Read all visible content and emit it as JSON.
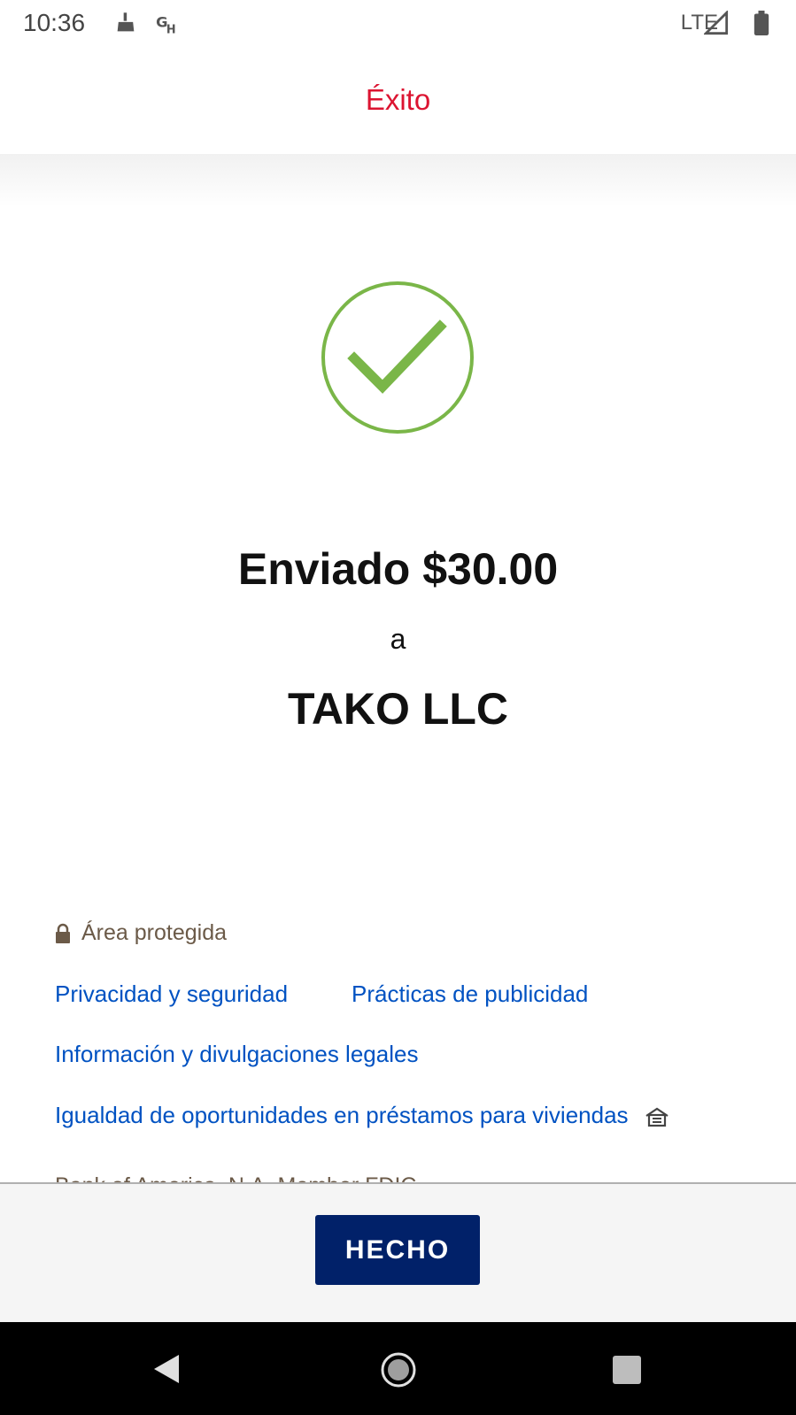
{
  "status_bar": {
    "time": "10:36",
    "network": "LTE",
    "icons": [
      "cleaner-icon",
      "gh-icon",
      "signal-icon",
      "battery-icon"
    ]
  },
  "header": {
    "title": "Éxito"
  },
  "confirmation": {
    "amount_line": "Enviado $30.00",
    "connector": "a",
    "recipient": "TAKO LLC",
    "icon": "checkmark-circle-icon",
    "icon_color": "#7ab648"
  },
  "footer_links": {
    "secure_label": "Área protegida",
    "privacy": "Privacidad y seguridad",
    "advertising": "Prácticas de publicidad",
    "legal": "Información y divulgaciones legales",
    "equal_housing": "Igualdad de oportunidades en préstamos para viviendas",
    "clipped_text": "Bank of America, N.A. Member FDIC"
  },
  "actions": {
    "done_label": "HECHO"
  },
  "colors": {
    "title_red": "#dc1431",
    "link_blue": "#0052c2",
    "button_navy": "#012169"
  },
  "nav": {
    "icons": [
      "back-icon",
      "home-icon",
      "recents-icon"
    ]
  }
}
